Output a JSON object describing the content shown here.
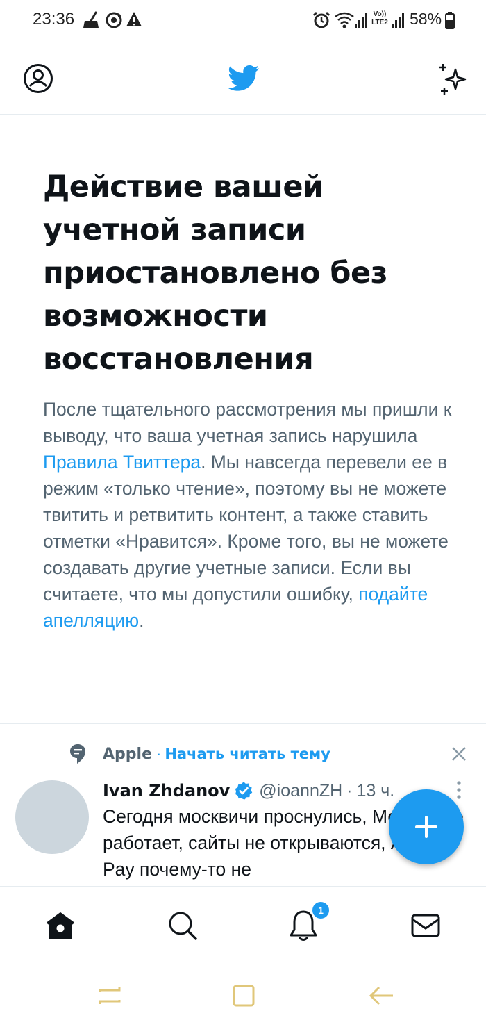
{
  "status_bar": {
    "time": "23:36",
    "battery": "58%",
    "left_icons": [
      "broom-icon",
      "sync-icon",
      "warning-icon"
    ],
    "right_icons": [
      "alarm-icon",
      "wifi-icon",
      "signal-icon",
      "volte-lte2-icon",
      "signal-icon",
      "battery-icon"
    ],
    "volte_label": "Vo))",
    "lte_label": "LTE2"
  },
  "header": {
    "left_icon": "profile-icon",
    "center_icon": "twitter-bird-icon",
    "right_icon": "sparkle-icon"
  },
  "notice": {
    "title": "Действие вашей учетной записи приостановлено без возможности восстановления",
    "body_1": "После тщательного рассмотрения мы пришли к выводу, что ваша учетная запись нарушила ",
    "rules_link": "Правила Твиттера",
    "body_2": ". Мы навсегда перевели ее в режим «только чтение», поэтому вы не можете твитить и ретвитить контент, а также ставить отметки «Нравится». Кроме того, вы не можете создавать другие учетные записи. Если вы считаете, что мы допустили ошибку, ",
    "appeal_link": "подайте апелляцию",
    "body_3": "."
  },
  "tweet": {
    "topic_name": "Apple",
    "topic_separator": "·",
    "topic_follow": "Начать читать тему",
    "author_name": "Ivan Zhdanov",
    "handle": "@ioannZH",
    "separator": "·",
    "time": "13 ч.",
    "text": "Сегодня москвичи проснулись, Москвы не работает, сайты не открываются, Apple Pay почему-то не"
  },
  "fab": {
    "icon": "plus-icon"
  },
  "bottom_nav": {
    "items": [
      "home-icon",
      "search-icon",
      "notifications-icon",
      "messages-icon"
    ],
    "notification_badge": "1"
  },
  "system_nav": [
    "recent-apps-icon",
    "home-button-icon",
    "back-icon"
  ],
  "colors": {
    "accent": "#1d9bf0",
    "text_primary": "#0f1419",
    "text_secondary": "#536471",
    "divider": "#e6ecf0",
    "avatar_placeholder": "#ccd6dd",
    "system_nav_icons": "#e0c77a"
  }
}
